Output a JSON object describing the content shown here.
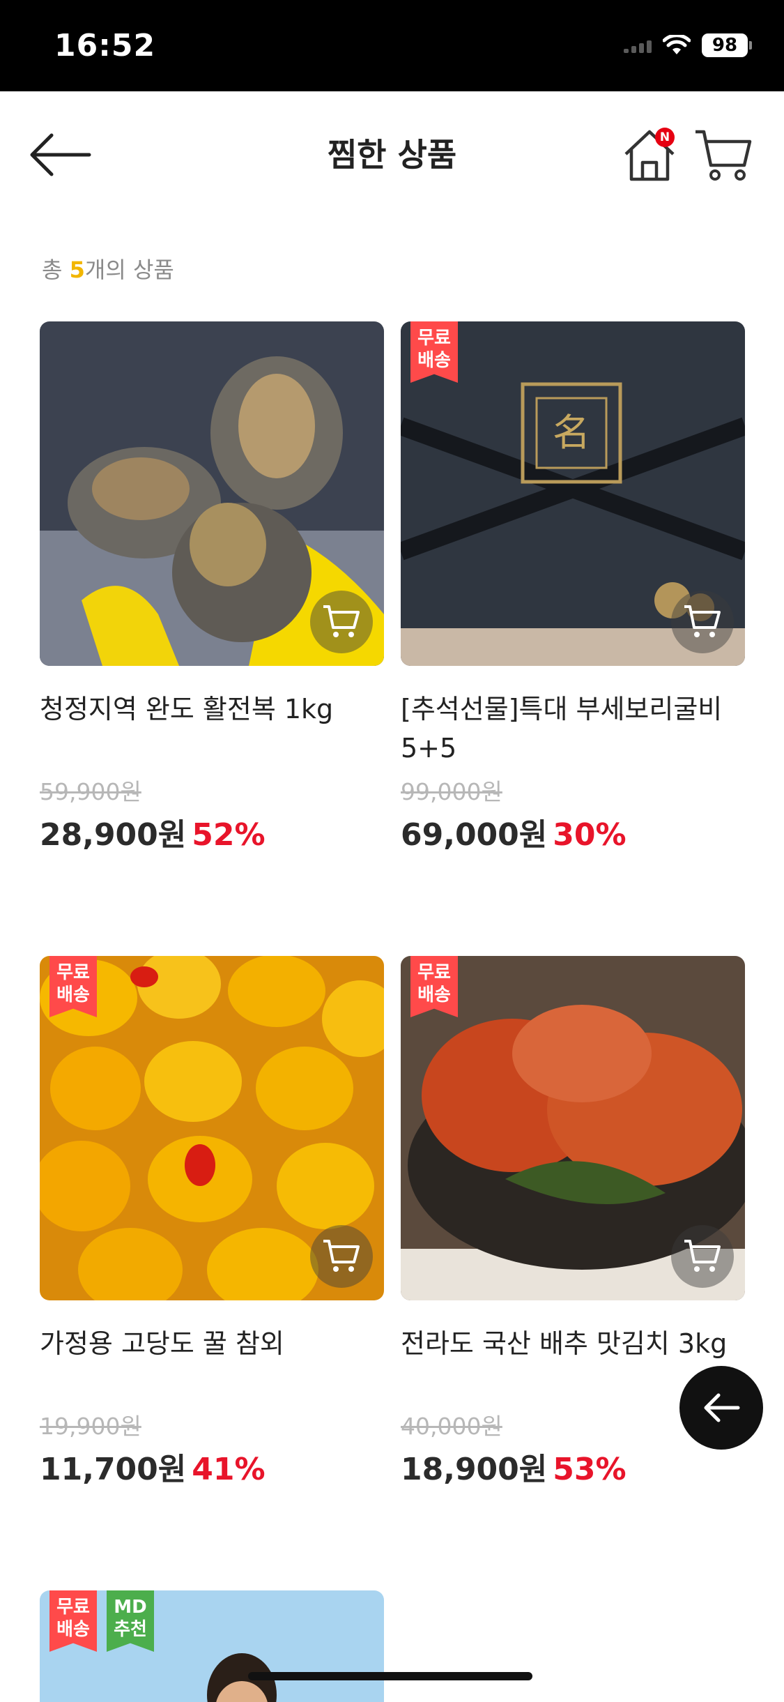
{
  "status_bar": {
    "time": "16:52",
    "battery": "98"
  },
  "header": {
    "title": "찜한 상품",
    "home_badge": "N"
  },
  "summary": {
    "prefix": "총 ",
    "count": "5",
    "suffix": "개의 상품"
  },
  "badges": {
    "free_shipping": "무료\n배송",
    "md_pick": "MD\n추천"
  },
  "products": [
    {
      "name": "청정지역 완도 활전복 1kg",
      "original_price": "59,900원",
      "sale_price": "28,900원",
      "discount": "52%",
      "free_shipping": false
    },
    {
      "name": "[추석선물]특대 부세보리굴비 5+5",
      "original_price": "99,000원",
      "sale_price": "69,000원",
      "discount": "30%",
      "free_shipping": true
    },
    {
      "name": "가정용 고당도 꿀 참외",
      "original_price": "19,900원",
      "sale_price": "11,700원",
      "discount": "41%",
      "free_shipping": true
    },
    {
      "name": "전라도 국산 배추 맛김치 3kg",
      "original_price": "40,000원",
      "sale_price": "18,900원",
      "discount": "53%",
      "free_shipping": true
    },
    {
      "name": "",
      "original_price": "",
      "sale_price": "",
      "discount": "",
      "free_shipping": true,
      "md_pick": true
    }
  ],
  "colors": {
    "accent_discount": "#e8142a",
    "count_highlight": "#f2b600",
    "free_badge": "#ff4a4a",
    "md_badge": "#4cae4c"
  }
}
